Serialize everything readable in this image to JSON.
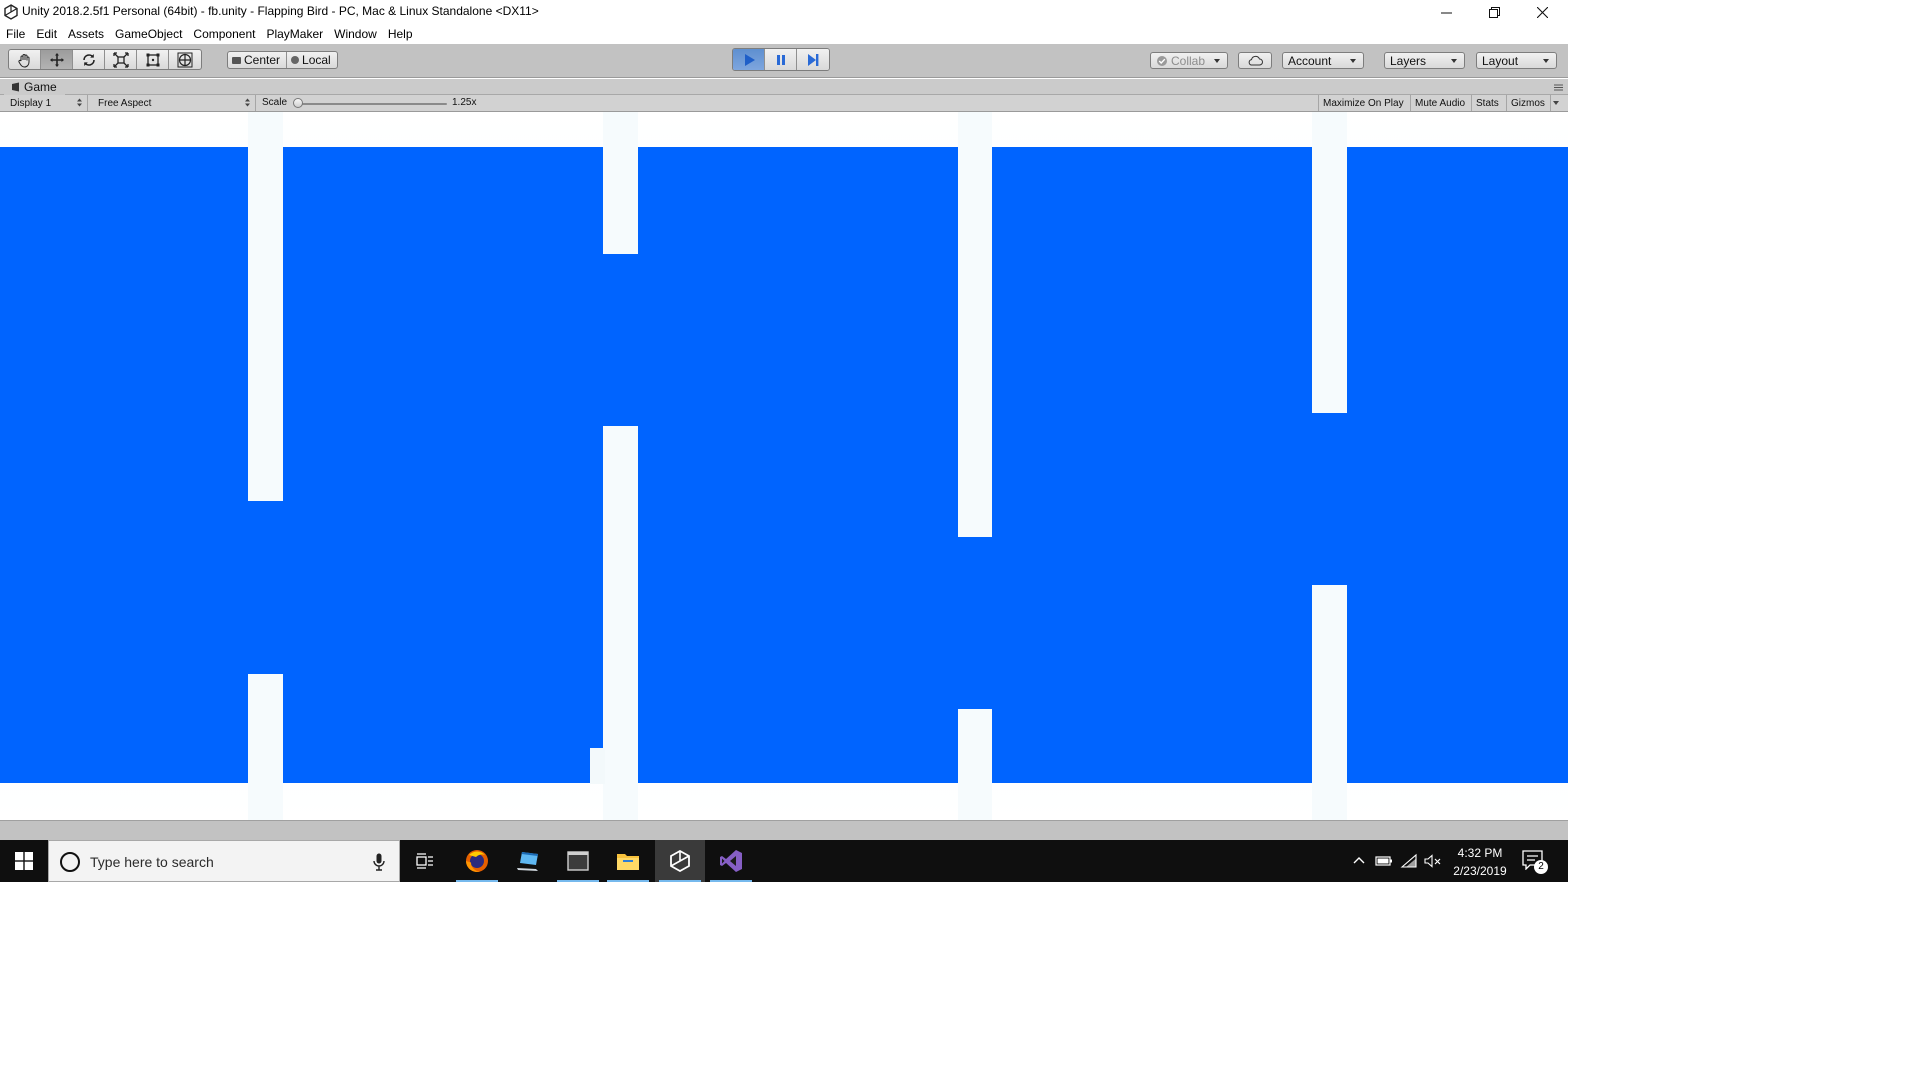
{
  "window": {
    "title": "Unity 2018.2.5f1 Personal (64bit) - fb.unity - Flapping Bird - PC, Mac & Linux Standalone <DX11>",
    "controls": [
      "minimize",
      "restore",
      "close"
    ]
  },
  "menubar": {
    "items": [
      "File",
      "Edit",
      "Assets",
      "GameObject",
      "Component",
      "PlayMaker",
      "Window",
      "Help"
    ]
  },
  "toolbar": {
    "transform_tools": [
      {
        "name": "hand-tool",
        "icon": "hand-icon"
      },
      {
        "name": "move-tool",
        "icon": "move-arrows-icon",
        "active": true
      },
      {
        "name": "rotate-tool",
        "icon": "rotate-icon"
      },
      {
        "name": "scale-tool",
        "icon": "scale-icon"
      },
      {
        "name": "rect-tool",
        "icon": "rect-icon"
      },
      {
        "name": "transform-tool",
        "icon": "transform-icon"
      }
    ],
    "pivot_label": "Center",
    "space_label": "Local",
    "play_state": "playing",
    "collab_label": "Collab",
    "account_label": "Account",
    "layers_label": "Layers",
    "layout_label": "Layout"
  },
  "game_view": {
    "tab_label": "Game",
    "display_label": "Display 1",
    "aspect_label": "Free Aspect",
    "scale_label": "Scale",
    "scale_value": "1.25x",
    "maximize_label": "Maximize On Play",
    "mute_label": "Mute Audio",
    "stats_label": "Stats",
    "gizmos_label": "Gizmos"
  },
  "colors": {
    "play_field": "#0064ff",
    "pipes": "#f6fbfd",
    "editor_toolbar": "#c2c2c2",
    "taskbar": "#0f0f0f"
  },
  "taskbar": {
    "search_placeholder": "Type here to search",
    "apps": [
      {
        "name": "task-view",
        "icon": "task-view-icon"
      },
      {
        "name": "firefox",
        "icon": "firefox-icon"
      },
      {
        "name": "remote-desktop",
        "icon": "computer-icon"
      },
      {
        "name": "app-window",
        "icon": "window-icon"
      },
      {
        "name": "file-explorer",
        "icon": "folder-icon"
      },
      {
        "name": "unity",
        "icon": "unity-icon",
        "active": true
      },
      {
        "name": "visual-studio",
        "icon": "visual-studio-icon"
      }
    ],
    "time": "4:32 PM",
    "date": "2/23/2019",
    "notification_count": "2"
  }
}
